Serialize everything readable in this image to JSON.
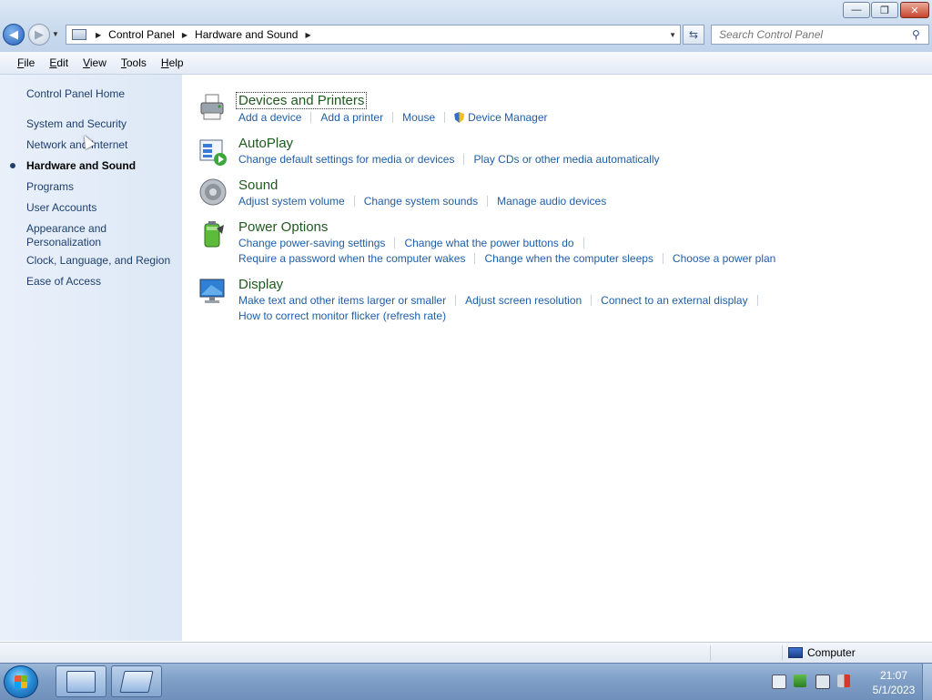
{
  "window": {
    "min_label": "—",
    "max_label": "❐",
    "close_label": "✕"
  },
  "nav": {
    "back_icon": "back-arrow-icon",
    "forward_icon": "forward-arrow-icon"
  },
  "address": {
    "breadcrumbs": [
      "Control Panel",
      "Hardware and Sound"
    ]
  },
  "search": {
    "placeholder": "Search Control Panel"
  },
  "menu": {
    "items": [
      {
        "key": "F",
        "rest": "ile"
      },
      {
        "key": "E",
        "rest": "dit"
      },
      {
        "key": "V",
        "rest": "iew"
      },
      {
        "key": "T",
        "rest": "ools"
      },
      {
        "key": "H",
        "rest": "elp"
      }
    ]
  },
  "sidebar": {
    "items": [
      "Control Panel Home",
      "System and Security",
      "Network and Internet",
      "Hardware and Sound",
      "Programs",
      "User Accounts",
      "Appearance and",
      "Personalization",
      "Clock, Language, and Region",
      "Ease of Access"
    ]
  },
  "categories": [
    {
      "title": "Devices and Printers",
      "lines": [
        [
          "Add a device",
          "Add a printer",
          "Mouse",
          "Device Manager"
        ]
      ]
    },
    {
      "title": "AutoPlay",
      "lines": [
        [
          "Change default settings for media or devices",
          "Play CDs or other media automatically"
        ]
      ]
    },
    {
      "title": "Sound",
      "lines": [
        [
          "Adjust system volume",
          "Change system sounds",
          "Manage audio devices"
        ]
      ]
    },
    {
      "title": "Power Options",
      "lines": [
        [
          "Change power-saving settings",
          "Change what the power buttons do"
        ],
        [
          "Require a password when the computer wakes",
          "Change when the computer sleeps",
          "Choose a power plan"
        ]
      ]
    },
    {
      "title": "Display",
      "lines": [
        [
          "Make text and other items larger or smaller",
          "Adjust screen resolution",
          "Connect to an external display"
        ],
        [
          "How to correct monitor flicker (refresh rate)"
        ]
      ]
    }
  ],
  "status": {
    "computer": "Computer"
  },
  "tray": {
    "time": "21:07",
    "date": "5/1/2023"
  },
  "colors": {
    "link": "#1f5ea8",
    "category_title": "#1e5a1e",
    "sidebar_bg": "#e3ecf8"
  }
}
